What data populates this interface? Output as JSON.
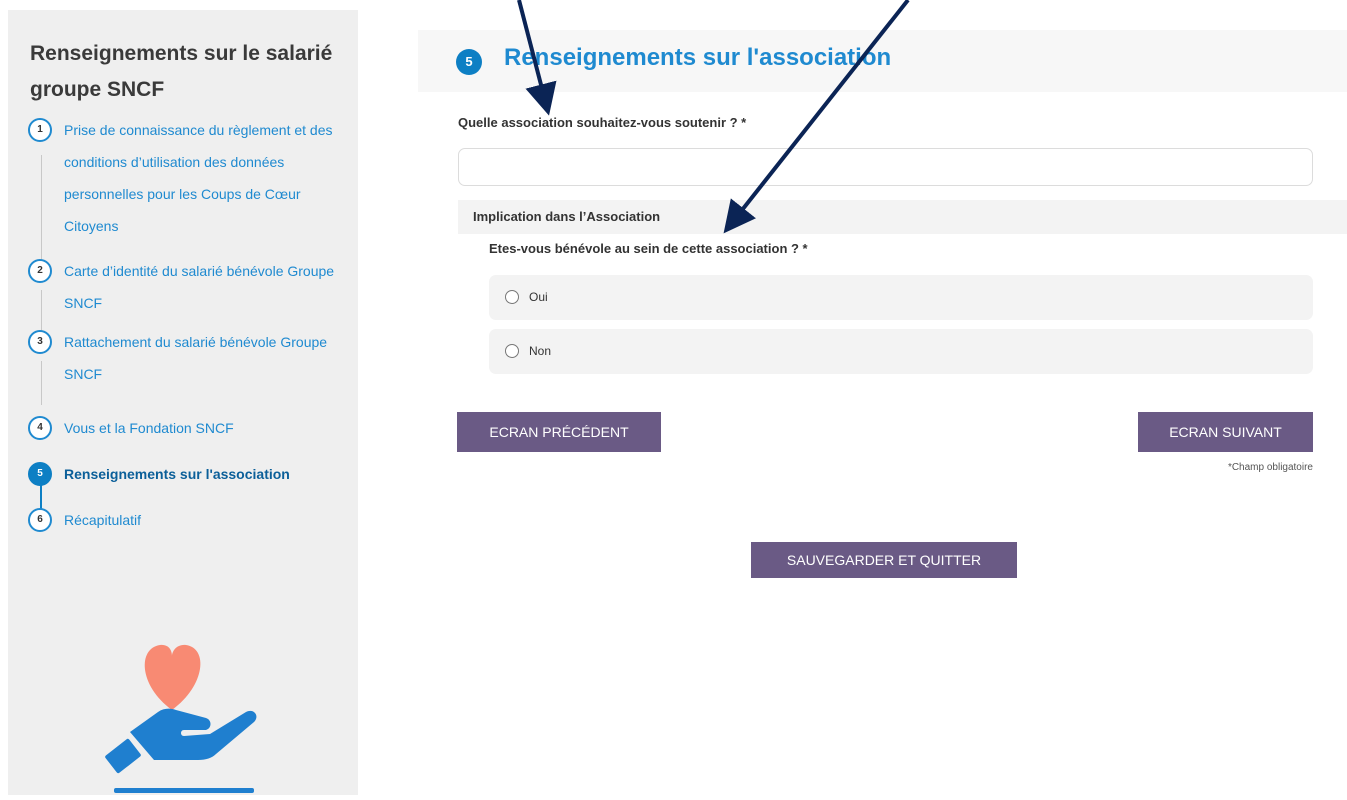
{
  "sidebar": {
    "title": "Renseignements sur le salarié groupe SNCF",
    "steps": [
      {
        "number": "1",
        "label": "Prise de connaissance du règlement et des conditions d’utilisation des données personnelles pour les Coups de Cœur Citoyens"
      },
      {
        "number": "2",
        "label": "Carte d’identité du salarié bénévole Groupe SNCF"
      },
      {
        "number": "3",
        "label": "Rattachement du salarié bénévole Groupe SNCF"
      },
      {
        "number": "4",
        "label": "Vous et la Fondation SNCF"
      },
      {
        "number": "5",
        "label": "Renseignements sur l'association",
        "active": true
      },
      {
        "number": "6",
        "label": "Récapitulatif"
      }
    ],
    "illustration": "hand-holding-heart",
    "colors": {
      "heart": "#f88a73",
      "hand": "#1f7fcf"
    }
  },
  "main": {
    "step_number": "5",
    "title": "Renseignements sur l'association",
    "question_association": "Quelle association souhaitez-vous soutenir ? *",
    "association_value": "",
    "section_title": "Implication dans l’Association",
    "question_volunteer": "Etes-vous bénévole au sein de cette association ? *",
    "options": [
      {
        "label": "Oui",
        "selected": false
      },
      {
        "label": "Non",
        "selected": false
      }
    ],
    "btn_prev": "ECRAN PRÉCÉDENT",
    "btn_next": "ECRAN SUIVANT",
    "required_note": "*Champ obligatoire",
    "btn_save": "SAUVEGARDER ET QUITTER"
  },
  "colors": {
    "accent": "#0d7fc4",
    "link": "#1f8ad0",
    "button": "#6a5a85",
    "arrow": "#0b2455"
  }
}
